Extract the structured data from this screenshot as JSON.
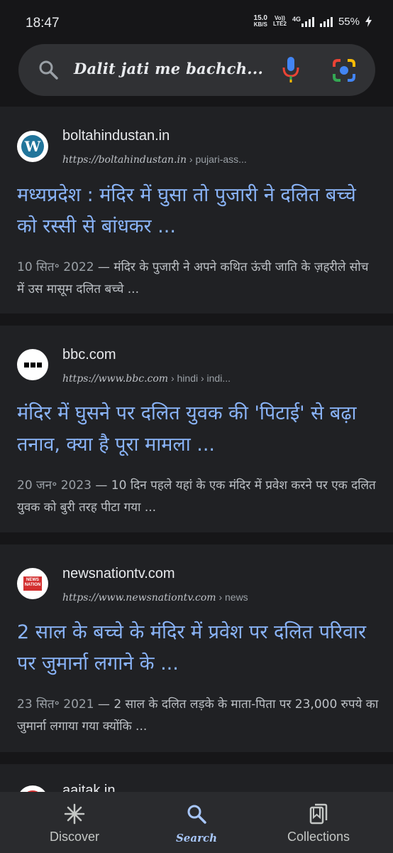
{
  "status_bar": {
    "time": "18:47",
    "net_speed": "15.0",
    "net_unit": "KB/S",
    "volte_top": "Vo))",
    "volte_bottom": "LTE2",
    "network": "4G",
    "battery": "55%"
  },
  "search": {
    "query": "Dalit jati me bachch...",
    "icons": [
      "search-icon",
      "mic-icon",
      "lens-icon"
    ]
  },
  "results": [
    {
      "site": "boltahindustan.in",
      "url_base": "https://boltahindustan.in",
      "url_path": " › pujari-ass...",
      "title": "मध्यप्रदेश : मंदिर में घुसा तो पुजारी ने दलित बच्चे को रस्सी से बांधकर ...",
      "date": "10 सित॰ 2022",
      "snippet": " — मंदिर के पुजारी ने अपने कथित ऊंची जाति के ज़हरीले सोच में उस मासूम दलित बच्चे ...",
      "favicon": "wordpress-logo"
    },
    {
      "site": "bbc.com",
      "url_base": "https://www.bbc.com",
      "url_path": " › hindi › indi...",
      "title": "मंदिर में घुसने पर दलित युवक की 'पिटाई' से बढ़ा तनाव, क्या है पूरा मामला ...",
      "date": "20 जन॰ 2023",
      "snippet": " — 10 दिन पहले यहां के एक मंदिर में प्रवेश करने पर एक दलित युवक को बुरी तरह पीटा गया ...",
      "favicon": "bbc-logo"
    },
    {
      "site": "newsnationtv.com",
      "url_base": "https://www.newsnationtv.com",
      "url_path": " › news",
      "title": "2 साल के बच्चे के मंदिर में प्रवेश पर दलित परिवार पर जुमार्ना लगाने के ...",
      "date": "23 सित॰ 2021",
      "snippet": " — 2 साल के दलित लड़के के माता-पिता पर 23,000 रुपये का जुमार्ना लगाया गया क्योंकि ...",
      "favicon": "newsnation-logo",
      "favicon_text_top": "NEWS",
      "favicon_text_bottom": "NATION"
    },
    {
      "site": "aajtak.in"
    }
  ],
  "bottom_nav": [
    {
      "label": "Discover",
      "icon": "asterisk-icon"
    },
    {
      "label": "Search",
      "icon": "search-icon",
      "active": true
    },
    {
      "label": "Collections",
      "icon": "collections-icon"
    }
  ],
  "colors": {
    "background": "#161618",
    "card": "#202124",
    "link": "#8ab4f8",
    "active_nav": "#a8c7fa"
  }
}
